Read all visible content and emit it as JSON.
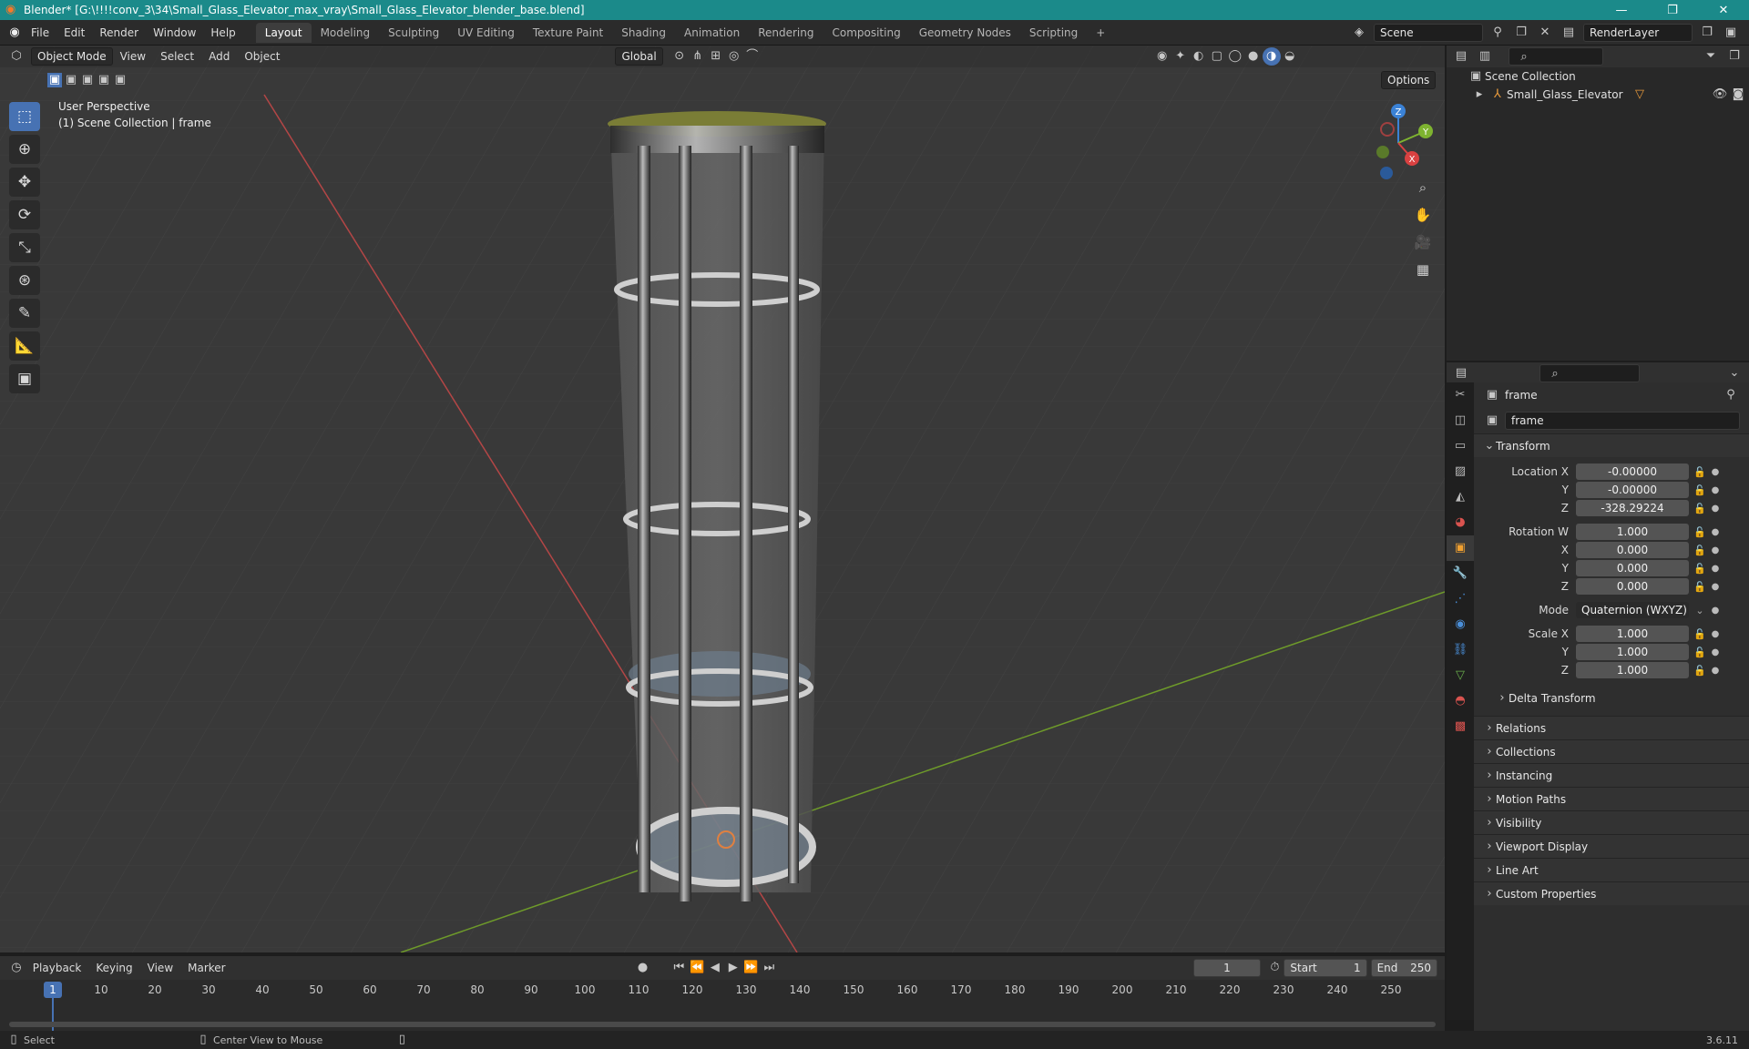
{
  "window": {
    "title": "Blender* [G:\\!!!!conv_3\\34\\Small_Glass_Elevator_max_vray\\Small_Glass_Elevator_blender_base.blend]"
  },
  "menu": [
    "File",
    "Edit",
    "Render",
    "Window",
    "Help"
  ],
  "workspaces": [
    "Layout",
    "Modeling",
    "Sculpting",
    "UV Editing",
    "Texture Paint",
    "Shading",
    "Animation",
    "Rendering",
    "Compositing",
    "Geometry Nodes",
    "Scripting"
  ],
  "active_workspace": "Layout",
  "scene_name": "Scene",
  "render_layer": "RenderLayer",
  "viewport": {
    "mode": "Object Mode",
    "menus": [
      "View",
      "Select",
      "Add",
      "Object"
    ],
    "transform_orientation": "Global",
    "options_label": "Options",
    "info_line1": "User Perspective",
    "info_line2": "(1) Scene Collection | frame",
    "gizmo": {
      "z": "Z",
      "y": "Y",
      "x": "X"
    }
  },
  "outliner": {
    "root": "Scene Collection",
    "items": [
      {
        "name": "Small_Glass_Elevator"
      }
    ]
  },
  "properties": {
    "object_name": "frame",
    "datablock_name": "frame",
    "transform_label": "Transform",
    "location": {
      "label_x": "Location X",
      "label_y": "Y",
      "label_z": "Z",
      "x": "-0.00000",
      "y": "-0.00000",
      "z": "-328.29224"
    },
    "rotation": {
      "label_w": "Rotation W",
      "label_x": "X",
      "label_y": "Y",
      "label_z": "Z",
      "w": "1.000",
      "x": "0.000",
      "y": "0.000",
      "z": "0.000"
    },
    "mode_label": "Mode",
    "mode_value": "Quaternion (WXYZ)",
    "scale": {
      "label_x": "Scale X",
      "label_y": "Y",
      "label_z": "Z",
      "x": "1.000",
      "y": "1.000",
      "z": "1.000"
    },
    "delta_transform": "Delta Transform",
    "panels": [
      "Relations",
      "Collections",
      "Instancing",
      "Motion Paths",
      "Visibility",
      "Viewport Display",
      "Line Art",
      "Custom Properties"
    ]
  },
  "timeline": {
    "menus": [
      "Playback",
      "Keying",
      "View",
      "Marker"
    ],
    "current_frame": "1",
    "start_label": "Start",
    "start": "1",
    "end_label": "End",
    "end": "250",
    "ticks": [
      "1",
      "10",
      "20",
      "30",
      "40",
      "50",
      "60",
      "70",
      "80",
      "90",
      "100",
      "110",
      "120",
      "130",
      "140",
      "150",
      "160",
      "170",
      "180",
      "190",
      "200",
      "210",
      "220",
      "230",
      "240",
      "250"
    ]
  },
  "status": {
    "select": "Select",
    "center_view": "Center View to Mouse",
    "version": "3.6.11"
  },
  "colors": {
    "accent": "#4772b3",
    "title_bar": "#1b8a8a",
    "x_axis": "#d94141",
    "y_axis": "#7eb330",
    "z_axis": "#3b82d6"
  }
}
